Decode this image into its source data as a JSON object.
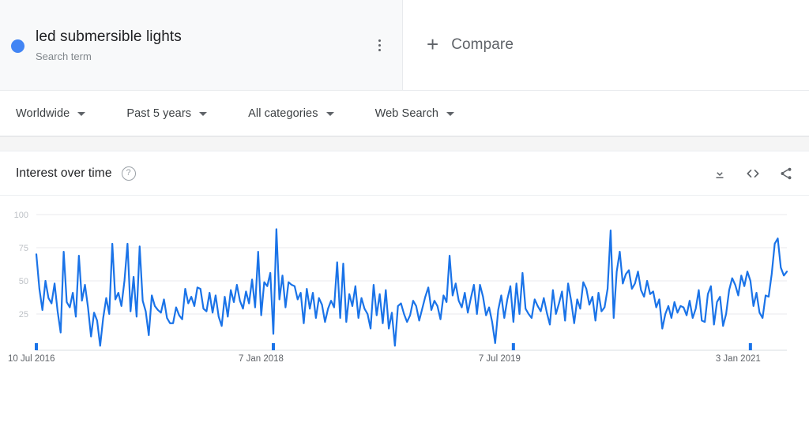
{
  "term": {
    "title": "led submersible lights",
    "subtitle": "Search term",
    "dot_color": "#4285F4",
    "menu_icon": "more-vert-icon"
  },
  "compare": {
    "label": "Compare",
    "plus_icon": "plus-icon"
  },
  "filters": [
    {
      "label": "Worldwide",
      "icon": "chevron-down-icon"
    },
    {
      "label": "Past 5 years",
      "icon": "chevron-down-icon"
    },
    {
      "label": "All categories",
      "icon": "chevron-down-icon"
    },
    {
      "label": "Web Search",
      "icon": "chevron-down-icon"
    }
  ],
  "card": {
    "title": "Interest over time",
    "help_icon": "help-circle-icon",
    "actions": [
      {
        "name": "download-icon",
        "label": "Download"
      },
      {
        "name": "embed-code-icon",
        "label": "Embed"
      },
      {
        "name": "share-icon",
        "label": "Share"
      }
    ]
  },
  "chart_data": {
    "type": "line",
    "title": "Interest over time",
    "xlabel": "",
    "ylabel": "",
    "ylim": [
      0,
      100
    ],
    "yticks": [
      100,
      75,
      50,
      25
    ],
    "grid": true,
    "legend": false,
    "line_color": "#1A73E8",
    "xtick_labels": [
      "10 Jul 2016",
      "7 Jan 2018",
      "7 Jul 2019",
      "3 Jan 2021"
    ],
    "xtick_positions": [
      0,
      78,
      157,
      235
    ],
    "series": [
      {
        "name": "led submersible lights",
        "values": [
          70,
          44,
          28,
          50,
          37,
          33,
          48,
          27,
          11,
          72,
          34,
          30,
          41,
          23,
          69,
          35,
          47,
          30,
          8,
          26,
          20,
          1,
          22,
          37,
          25,
          78,
          36,
          41,
          31,
          50,
          78,
          27,
          53,
          23,
          76,
          35,
          27,
          9,
          39,
          31,
          28,
          26,
          36,
          22,
          18,
          18,
          30,
          24,
          21,
          44,
          33,
          38,
          31,
          45,
          44,
          29,
          27,
          41,
          26,
          39,
          23,
          16,
          38,
          23,
          43,
          34,
          47,
          35,
          29,
          42,
          33,
          51,
          30,
          72,
          24,
          49,
          46,
          56,
          10,
          89,
          36,
          54,
          30,
          49,
          47,
          46,
          36,
          41,
          18,
          44,
          29,
          41,
          22,
          37,
          32,
          19,
          29,
          35,
          30,
          64,
          22,
          63,
          19,
          40,
          31,
          46,
          22,
          37,
          29,
          25,
          14,
          47,
          24,
          40,
          18,
          43,
          14,
          26,
          1,
          31,
          33,
          25,
          19,
          24,
          35,
          31,
          20,
          29,
          38,
          45,
          28,
          35,
          31,
          21,
          39,
          34,
          69,
          39,
          48,
          35,
          30,
          41,
          26,
          37,
          47,
          25,
          47,
          38,
          24,
          30,
          19,
          3,
          28,
          39,
          22,
          36,
          46,
          19,
          48,
          25,
          56,
          29,
          25,
          22,
          36,
          31,
          27,
          37,
          26,
          17,
          43,
          25,
          33,
          42,
          20,
          48,
          35,
          18,
          36,
          29,
          49,
          44,
          32,
          38,
          20,
          41,
          27,
          30,
          44,
          88,
          22,
          57,
          72,
          48,
          55,
          58,
          44,
          48,
          57,
          43,
          38,
          50,
          40,
          42,
          30,
          36,
          14,
          25,
          31,
          22,
          34,
          26,
          31,
          30,
          24,
          35,
          22,
          29,
          43,
          20,
          19,
          40,
          46,
          17,
          34,
          38,
          16,
          25,
          43,
          52,
          47,
          39,
          54,
          46,
          57,
          50,
          31,
          41,
          26,
          22,
          39,
          38,
          55,
          78,
          82,
          60,
          54,
          57
        ]
      }
    ]
  }
}
